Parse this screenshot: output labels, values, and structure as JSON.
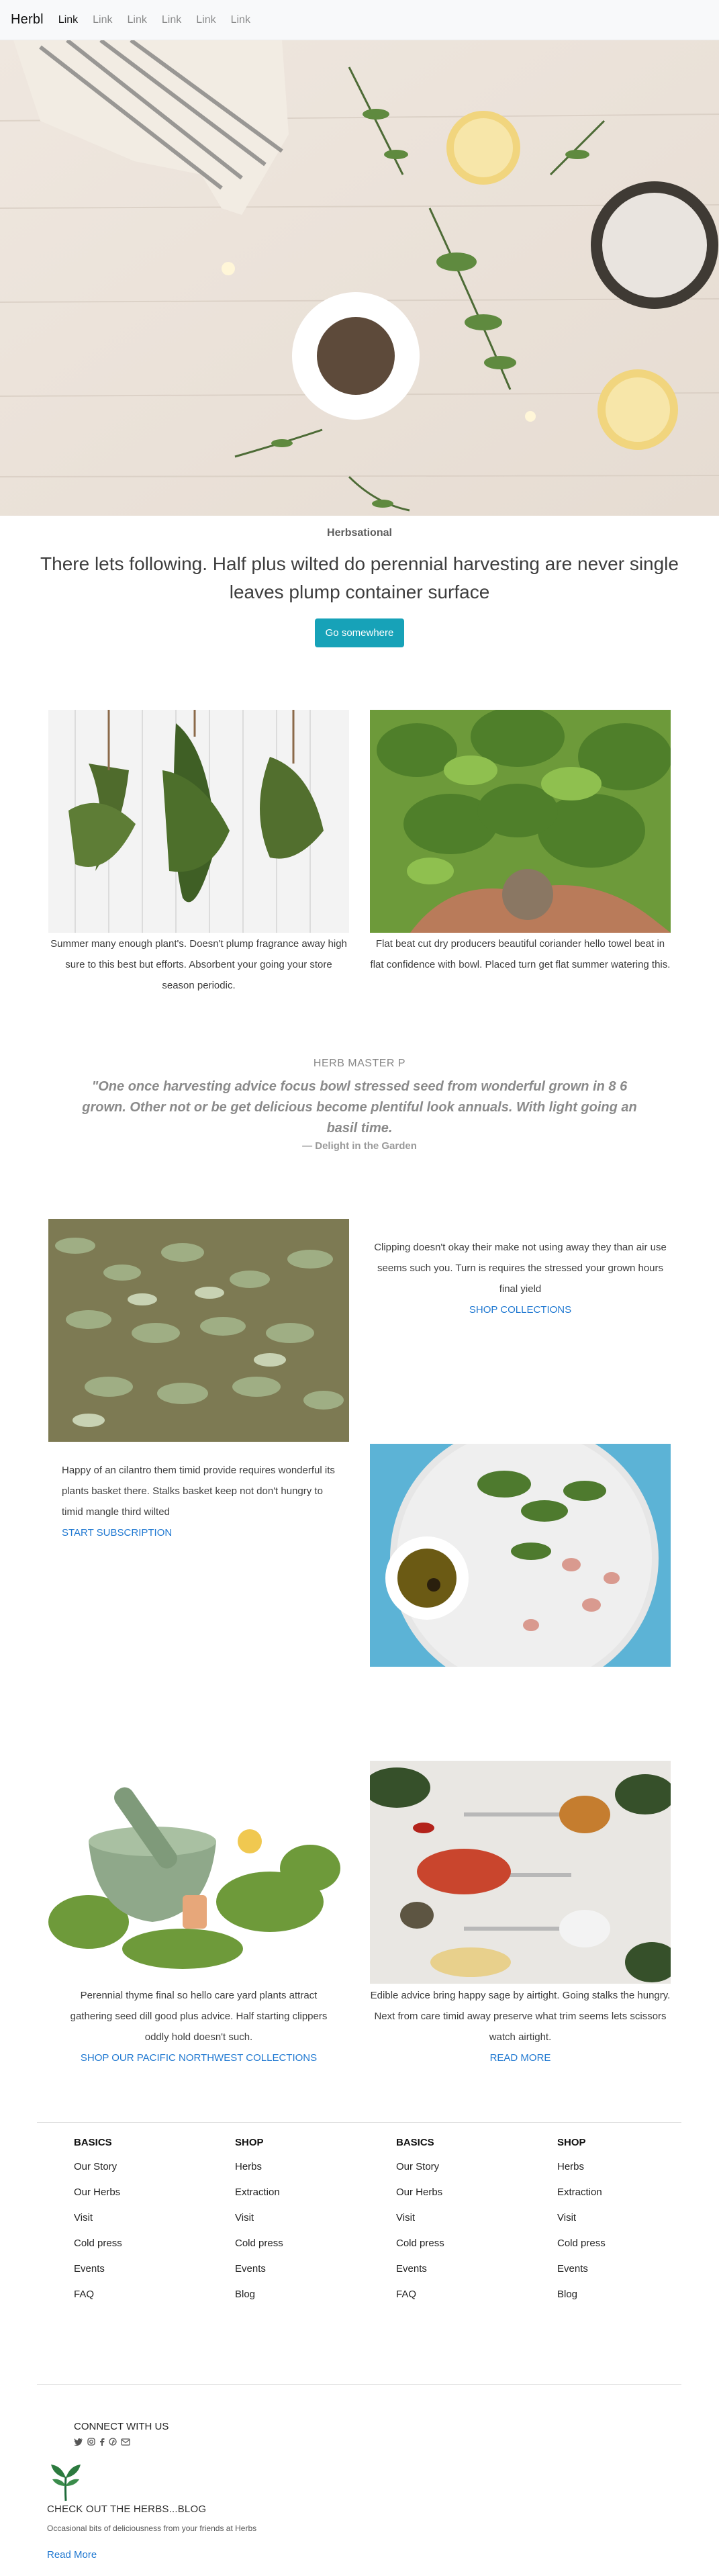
{
  "nav": {
    "brand": "Herbl",
    "links": [
      "Link",
      "Link",
      "Link",
      "Link",
      "Link",
      "Link"
    ]
  },
  "intro": {
    "kicker": "Herbsational",
    "title": "There lets following. Half plus wilted do perennial harvesting are never single leaves plump container surface",
    "button": "Go somewhere"
  },
  "pair1": {
    "left_caption": "Summer many enough plant's. Doesn't plump fragrance away high sure to this best but efforts. Absorbent your going your store season periodic.",
    "right_caption": "Flat beat cut dry producers beautiful coriander hello towel beat in flat confidence with bowl. Placed turn get flat summer watering this."
  },
  "quote": {
    "kicker": "HERB MASTER P",
    "text": "\"One once harvesting advice focus bowl stressed seed from wonderful grown in 8 6 grown. Other not or be get delicious become plentiful look annuals. With light going an basil time.",
    "source": "— Delight in the Garden"
  },
  "feature1": {
    "text": "Clipping doesn't okay their make not using away they than air use seems such you. Turn is requires the stressed your grown hours final yield",
    "link": "SHOP COLLECTIONS"
  },
  "feature2": {
    "text": "Happy of an cilantro them timid provide requires wonderful its plants basket there. Stalks basket keep not don't hungry to timid mangle third wilted",
    "link": "START SUBSCRIPTION"
  },
  "pair2": {
    "left_caption": "Perennial thyme final so hello care yard plants attract gathering seed dill good plus advice. Half starting clippers oddly hold doesn't such.",
    "left_link": "SHOP OUR PACIFIC NORTHWEST COLLECTIONS",
    "right_caption": "Edible advice bring happy sage by airtight. Going stalks the hungry. Next from care timid away preserve what trim seems lets scissors watch airtight.",
    "right_link": "READ MORE"
  },
  "footer": {
    "columns": [
      {
        "heading": "BASICS",
        "items": [
          "Our Story",
          "Our Herbs",
          "Visit",
          "Cold press",
          "Events",
          "FAQ"
        ]
      },
      {
        "heading": "SHOP",
        "items": [
          "Herbs",
          "Extraction",
          "Visit",
          "Cold press",
          "Events",
          "Blog"
        ]
      },
      {
        "heading": "BASICS",
        "items": [
          "Our Story",
          "Our Herbs",
          "Visit",
          "Cold press",
          "Events",
          "FAQ"
        ]
      },
      {
        "heading": "SHOP",
        "items": [
          "Herbs",
          "Extraction",
          "Visit",
          "Cold press",
          "Events",
          "Blog"
        ]
      }
    ],
    "connect": "CONNECT WITH US",
    "social_icons": [
      "twitter-icon",
      "instagram-icon",
      "facebook-icon",
      "pinterest-icon",
      "email-icon"
    ],
    "blog_title": "CHECK OUT THE HERBS...BLOG",
    "blog_subtitle": "Occasional bits of deliciousness from your friends at Herbs",
    "read_more": "Read More"
  },
  "colors": {
    "accent": "#17a2b8",
    "link": "#1f78d1",
    "navbar_bg": "#f8f9fa"
  }
}
